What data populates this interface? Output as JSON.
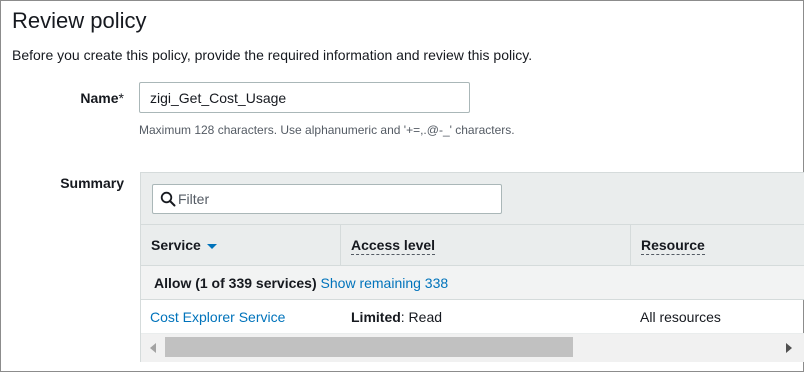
{
  "page": {
    "title": "Review policy",
    "intro": "Before you create this policy, provide the required information and review this policy."
  },
  "name_field": {
    "label": "Name",
    "required_mark": "*",
    "value": "zigi_Get_Cost_Usage",
    "hint": "Maximum 128 characters. Use alphanumeric and '+=,.@-_' characters."
  },
  "summary": {
    "label": "Summary",
    "filter": {
      "placeholder": "Filter",
      "icon": "search-icon"
    },
    "columns": [
      "Service",
      "Access level",
      "Resource"
    ],
    "sort_indicator": "chevron-down-icon",
    "group": {
      "title": "Allow (1 of 339 services)",
      "link": "Show remaining 338"
    },
    "rows": [
      {
        "service": "Cost Explorer Service",
        "access_level_bold": "Limited",
        "access_level_rest": ": Read",
        "resource": "All resources"
      }
    ]
  },
  "colors": {
    "link": "#0073bb",
    "header_bg": "#eaeded",
    "border": "#d5dbdb"
  }
}
